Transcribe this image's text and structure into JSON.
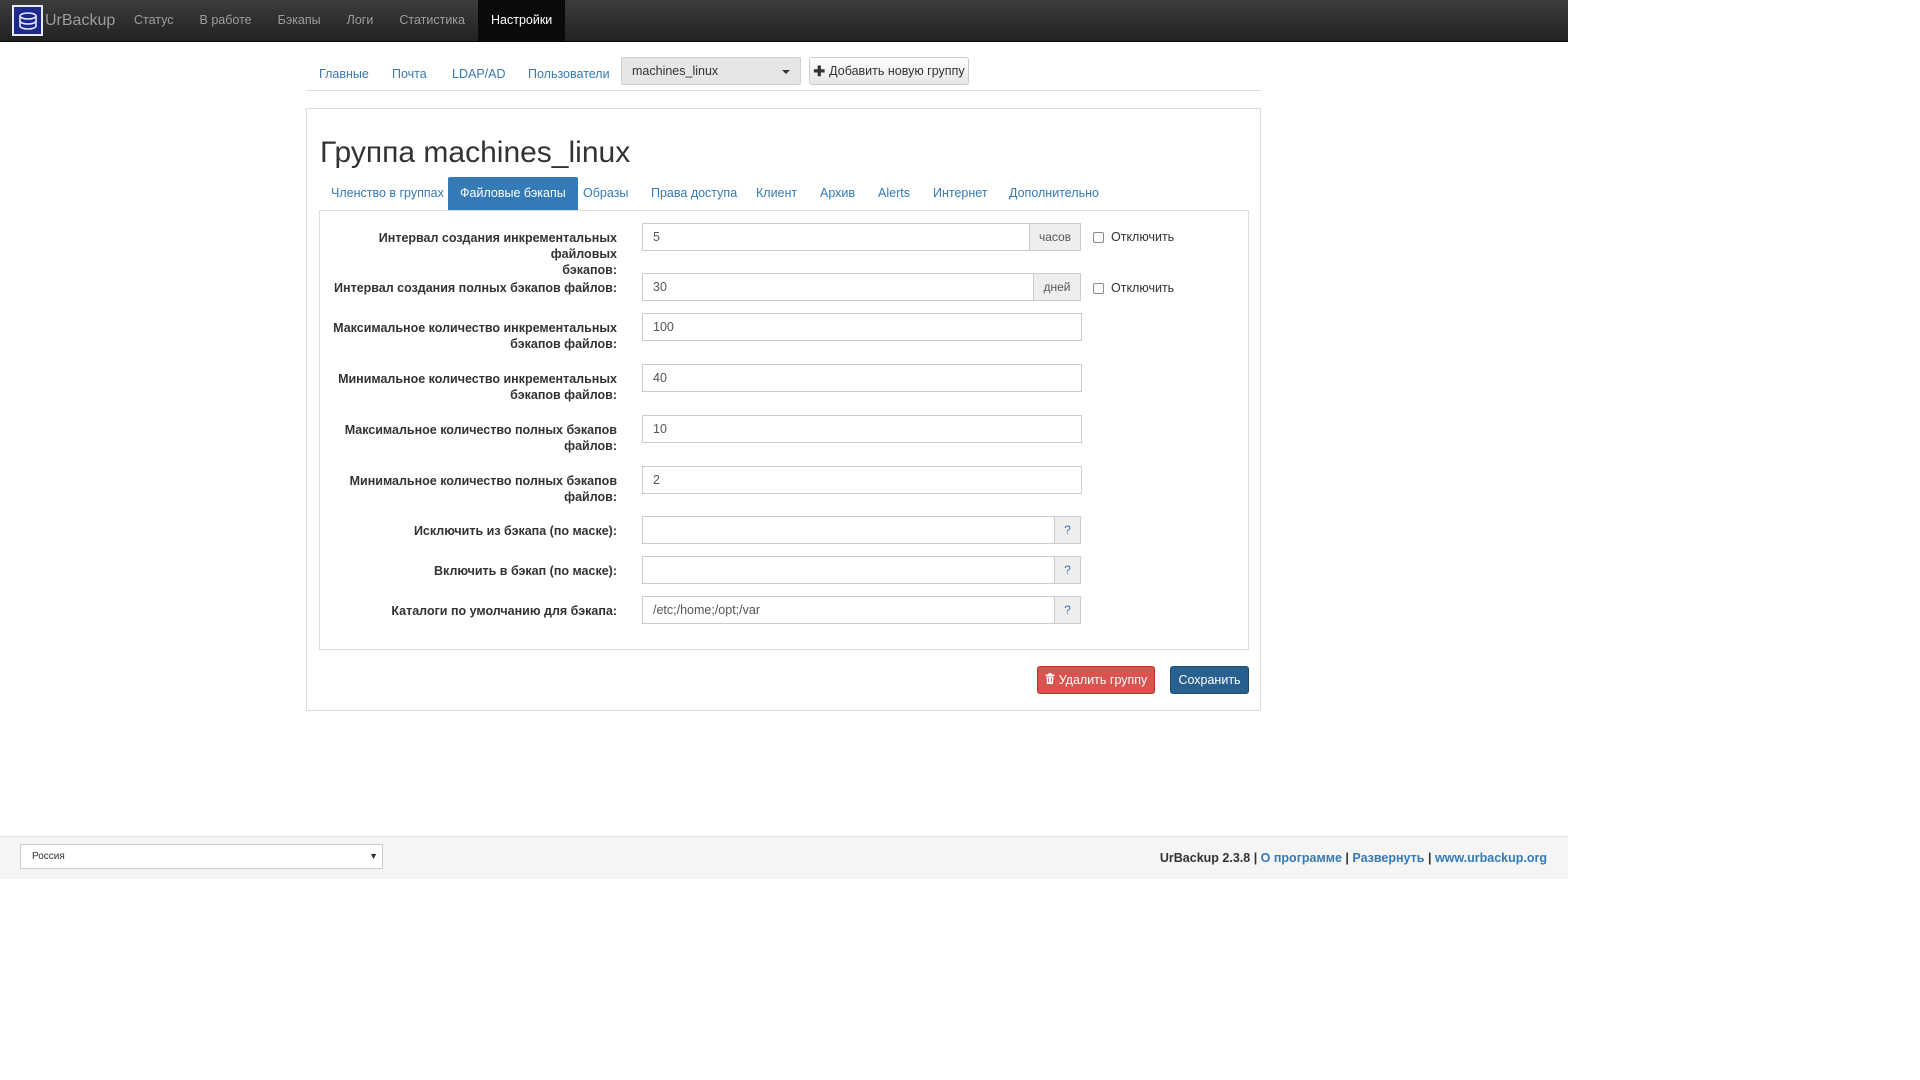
{
  "navbar": {
    "brand": "UrBackup",
    "items": [
      "Статус",
      "В работе",
      "Бэкапы",
      "Логи",
      "Статистика",
      "Настройки"
    ],
    "active": "Настройки"
  },
  "settings_tabs": {
    "items": [
      "Главные",
      "Почта",
      "LDAP/AD",
      "Пользователи"
    ],
    "group_select": "machines_linux",
    "add_group_label": "Добавить новую группу"
  },
  "group": {
    "title": "Группа machines_linux",
    "subtabs": [
      "Членство в группах",
      "Файловые бэкапы",
      "Образы",
      "Права доступа",
      "Клиент",
      "Архив",
      "Alerts",
      "Интернет",
      "Дополнительно"
    ],
    "active_subtab": "Файловые бэкапы"
  },
  "form": {
    "incr_interval": {
      "label_line1": "Интервал создания инкрементальных файловых",
      "label_line2": "бэкапов:",
      "value": "5",
      "unit": "часов",
      "disable_label": "Отключить"
    },
    "full_interval": {
      "label": "Интервал создания полных бэкапов файлов:",
      "value": "30",
      "unit": "дней",
      "disable_label": "Отключить"
    },
    "max_incr": {
      "label_line1": "Максимальное количество инкрементальных",
      "label_line2": "бэкапов файлов:",
      "value": "100"
    },
    "min_incr": {
      "label_line1": "Минимальное количество инкрементальных",
      "label_line2": "бэкапов файлов:",
      "value": "40"
    },
    "max_full": {
      "label_line1": "Максимальное количество полных бэкапов",
      "label_line2": "файлов:",
      "value": "10"
    },
    "min_full": {
      "label_line1": "Минимальное количество полных бэкапов",
      "label_line2": "файлов:",
      "value": "2"
    },
    "exclude": {
      "label": "Исключить из бэкапа (по маске):",
      "value": ""
    },
    "include": {
      "label": "Включить в бэкап (по маске):",
      "value": ""
    },
    "default_dirs": {
      "label": "Каталоги по умолчанию для бэкапа:",
      "value": "/etc;/home;/opt;/var"
    },
    "help_symbol": "?"
  },
  "buttons": {
    "delete": "Удалить группу",
    "save": "Сохранить"
  },
  "footer": {
    "language": "Россия",
    "version": "UrBackup 2.3.8",
    "sep": "|",
    "about": "О программе",
    "expand": "Развернуть",
    "site": "www.urbackup.org"
  }
}
